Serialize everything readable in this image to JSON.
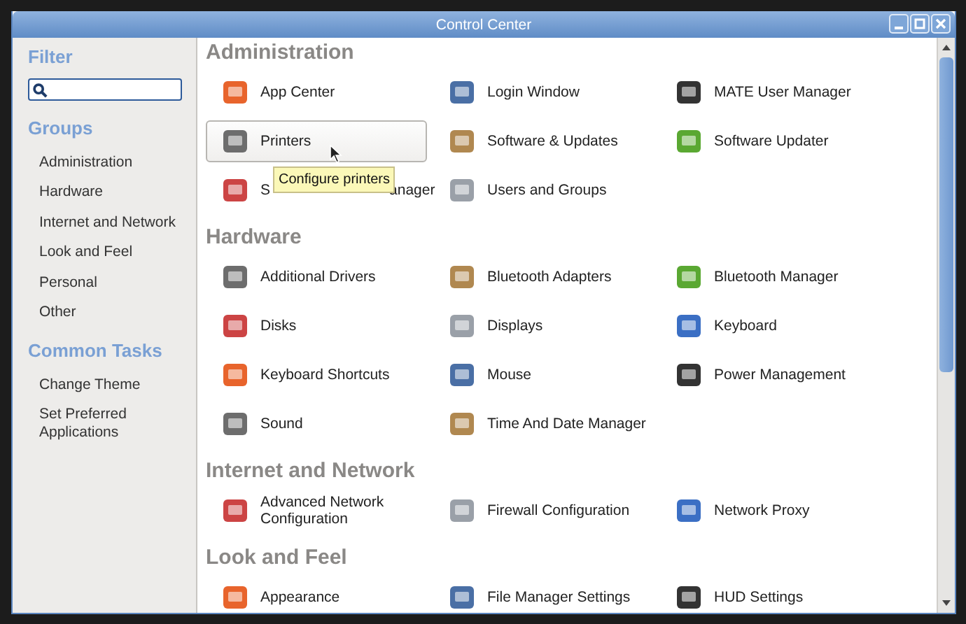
{
  "window": {
    "title": "Control Center"
  },
  "sidebar": {
    "filter_heading": "Filter",
    "groups_heading": "Groups",
    "groups": [
      {
        "label": "Administration"
      },
      {
        "label": "Hardware"
      },
      {
        "label": "Internet and Network"
      },
      {
        "label": "Look and Feel"
      },
      {
        "label": "Personal"
      },
      {
        "label": "Other"
      }
    ],
    "tasks_heading": "Common Tasks",
    "tasks": [
      {
        "label": "Change Theme"
      },
      {
        "label": "Set Preferred Applications"
      }
    ]
  },
  "sections": [
    {
      "title": "Administration",
      "items": [
        {
          "label": "App Center",
          "selected": false
        },
        {
          "label": "Login Window",
          "selected": false
        },
        {
          "label": "MATE User Manager",
          "selected": false
        },
        {
          "label": "Printers",
          "selected": true,
          "tooltip": "Configure printers"
        },
        {
          "label": "Software & Updates",
          "selected": false
        },
        {
          "label": "Software Updater",
          "selected": false
        },
        {
          "label": "S",
          "label_end": "anager",
          "selected": false
        },
        {
          "label": "Users and Groups",
          "selected": false
        }
      ]
    },
    {
      "title": "Hardware",
      "items": [
        {
          "label": "Additional Drivers",
          "selected": false
        },
        {
          "label": "Bluetooth Adapters",
          "selected": false
        },
        {
          "label": "Bluetooth Manager",
          "selected": false
        },
        {
          "label": "Disks",
          "selected": false
        },
        {
          "label": "Displays",
          "selected": false
        },
        {
          "label": "Keyboard",
          "selected": false
        },
        {
          "label": "Keyboard Shortcuts",
          "selected": false
        },
        {
          "label": "Mouse",
          "selected": false
        },
        {
          "label": "Power Management",
          "selected": false
        },
        {
          "label": "Sound",
          "selected": false
        },
        {
          "label": "Time And Date Manager",
          "selected": false
        }
      ]
    },
    {
      "title": "Internet and Network",
      "items": [
        {
          "label": "Advanced Network Configuration",
          "selected": false
        },
        {
          "label": "Firewall Configuration",
          "selected": false
        },
        {
          "label": "Network Proxy",
          "selected": false
        }
      ]
    },
    {
      "title": "Look and Feel",
      "items": [
        {
          "label": "Appearance",
          "selected": false
        },
        {
          "label": "File Manager Settings",
          "selected": false
        },
        {
          "label": "HUD Settings",
          "selected": false
        }
      ]
    }
  ]
}
